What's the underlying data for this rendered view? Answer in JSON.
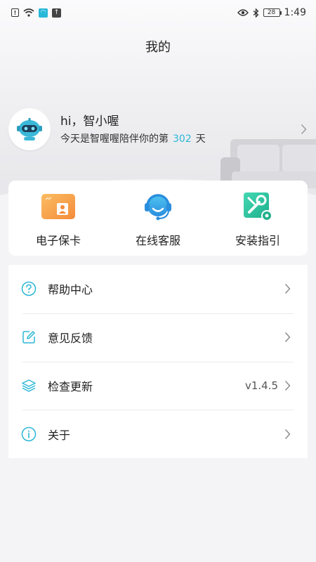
{
  "status_bar": {
    "time": "1:49",
    "battery": "28",
    "left_icons": [
      "sim-alert-icon",
      "wifi-icon",
      "app-notification-icon",
      "upload-notification-icon"
    ],
    "right_icons": [
      "eye-icon",
      "bluetooth-icon",
      "battery-icon"
    ]
  },
  "page": {
    "title": "我的"
  },
  "profile": {
    "greeting": "hi，智小喔",
    "days_prefix": "今天是智喔喔陪伴你的第",
    "days_count": "302",
    "days_suffix": "天",
    "avatar_icon": "robot-avatar-icon"
  },
  "quick_actions": [
    {
      "label": "电子保卡",
      "icon": "warranty-card-icon",
      "color": "#f7a14a"
    },
    {
      "label": "在线客服",
      "icon": "customer-service-icon",
      "color": "#32a9e6"
    },
    {
      "label": "安装指引",
      "icon": "install-guide-icon",
      "color": "#2ec5a0"
    }
  ],
  "menu": [
    {
      "label": "帮助中心",
      "icon": "help-icon",
      "value": ""
    },
    {
      "label": "意见反馈",
      "icon": "feedback-icon",
      "value": ""
    },
    {
      "label": "检查更新",
      "icon": "layers-icon",
      "value": "v1.4.5"
    },
    {
      "label": "关于",
      "icon": "info-icon",
      "value": ""
    }
  ],
  "colors": {
    "accent": "#2bb7d6",
    "background": "#f4f4f6"
  }
}
